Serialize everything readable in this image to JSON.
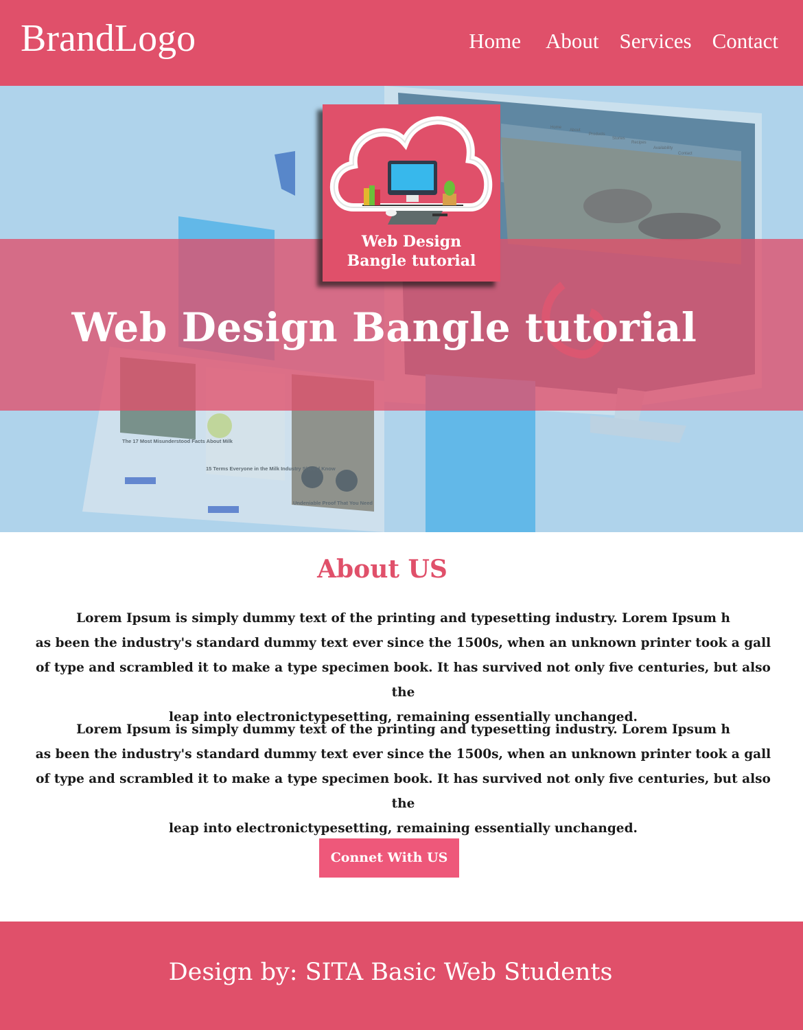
{
  "header": {
    "brand": "BrandLogo",
    "nav": [
      "Home",
      "About",
      "Services",
      "Contact"
    ]
  },
  "hero": {
    "logo_line1": "Web Design",
    "logo_line2": "Bangle tutorial",
    "title": "Web Design Bangle tutorial",
    "mockup_nav": [
      "Home",
      "About",
      "Products",
      "Stories",
      "Recipes",
      "Availability",
      "Contact"
    ],
    "mockup_cards": [
      "The 17 Most Misunderstood Facts About Milk",
      "15 Terms Everyone in the Milk Industry Should Know",
      "Undeniable Proof That You Need"
    ]
  },
  "about": {
    "title": "About US",
    "para1": [
      "Lorem Ipsum is simply dummy text of the printing and typesetting industry. Lorem Ipsum h",
      "as been the industry's standard dummy text ever since the 1500s, when an unknown printer took a gall",
      "of type and scrambled it to make a type specimen book. It has survived not only five centuries, but also the",
      "leap into electronictypesetting, remaining essentially unchanged."
    ],
    "para2": [
      "Lorem Ipsum is simply dummy text of the printing and typesetting industry. Lorem Ipsum h",
      "as been the industry's standard dummy text ever since the 1500s, when an unknown printer took a gall",
      "of type and scrambled it to make a type specimen book. It has survived not only five centuries, but also the",
      "leap into electronictypesetting, remaining essentially unchanged."
    ],
    "cta": "Connet With US"
  },
  "footer": {
    "text": "Design by: SITA Basic Web Students"
  },
  "colors": {
    "brand_pink": "#e0506a",
    "button_pink": "#ee587a",
    "hero_blue": "#b0d3ec"
  }
}
